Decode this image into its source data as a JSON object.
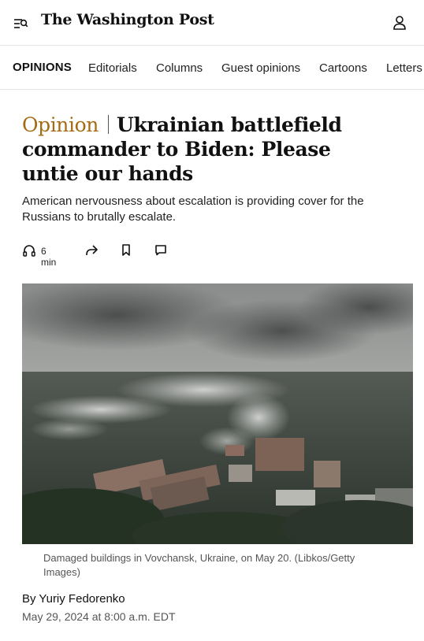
{
  "header": {
    "logo_text": "The Washington Post",
    "menu_icon": "menu-search-icon",
    "account_icon": "user-icon"
  },
  "section_nav": {
    "label": "OPINIONS",
    "items": [
      "Editorials",
      "Columns",
      "Guest opinions",
      "Cartoons",
      "Letters"
    ]
  },
  "article": {
    "kicker": "Opinion",
    "headline": "Ukrainian battlefield commander to Biden: Please untie our hands",
    "dek": "American nervousness about escalation is providing cover for the Russians to brutally escalate.",
    "listen_time": "6 min",
    "actions": [
      "headphones-icon",
      "share-icon",
      "bookmark-icon",
      "comment-icon"
    ],
    "photo": {
      "subject": "aerial-smoke-city-photo"
    },
    "caption": "Damaged buildings in Vovchansk, Ukraine, on May 20. (Libkos/Getty Images)",
    "byline_prefix": "By",
    "author": "Yuriy Fedorenko",
    "date": "May 29, 2024 at 8:00 a.m. EDT"
  },
  "colors": {
    "kicker": "#a56b14",
    "text": "#111111",
    "muted": "#555555",
    "divider": "#e5e5e5"
  }
}
